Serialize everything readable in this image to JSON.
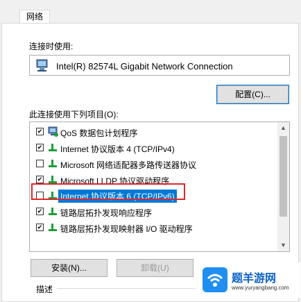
{
  "tab": {
    "label": "网络"
  },
  "connection": {
    "label": "连接时使用:",
    "adapter": "Intel(R) 82574L Gigabit Network Connection"
  },
  "buttons": {
    "configure": "配置(C)...",
    "install": "安装(N)...",
    "uninstall": "卸载(U)"
  },
  "items_label": "此连接使用下列项目(O):",
  "items": [
    {
      "label": "QoS 数据包计划程序",
      "checked": true,
      "icon": "qos-network-icon"
    },
    {
      "label": "Internet 协议版本 4 (TCP/IPv4)",
      "checked": true,
      "icon": "protocol-icon"
    },
    {
      "label": "Microsoft 网络适配器多路传送器协议",
      "checked": false,
      "icon": "protocol-icon"
    },
    {
      "label": "Microsoft LLDP 协议驱动程序",
      "checked": true,
      "icon": "protocol-icon"
    },
    {
      "label": "Internet 协议版本 6 (TCP/IPv6)",
      "checked": false,
      "icon": "protocol-icon",
      "selected": true
    },
    {
      "label": "链路层拓扑发现响应程序",
      "checked": true,
      "icon": "protocol-icon"
    },
    {
      "label": "链路层拓扑发现映射器 I/O 驱动程序",
      "checked": true,
      "icon": "protocol-icon"
    }
  ],
  "describe_label": "描述",
  "watermark": {
    "title": "题羊游网",
    "url": "www.yuryangbang.com"
  },
  "colors": {
    "selection": "#0078d7",
    "highlight_box": "#e0262a",
    "protocol_green": "#1e9e3c"
  }
}
